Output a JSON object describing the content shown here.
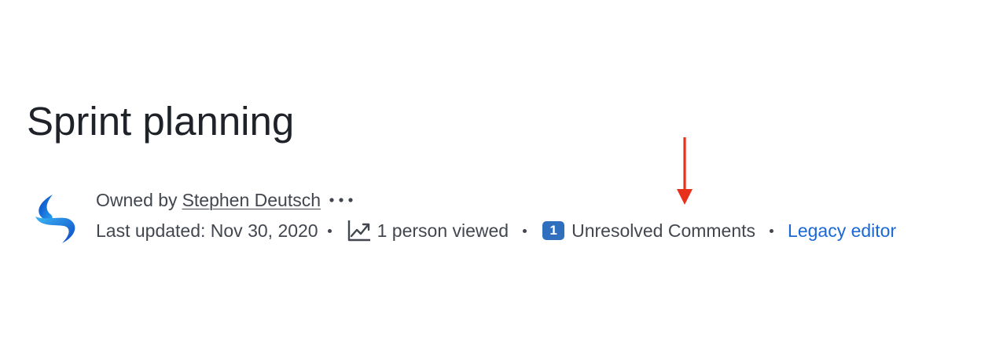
{
  "page": {
    "title": "Sprint planning"
  },
  "byline": {
    "owner_prefix": "Owned by",
    "owner_name": "Stephen Deutsch",
    "more_icon": "more-horizontal-icon",
    "avatar_icon": "space-logo"
  },
  "meta": {
    "last_updated": "Last updated: Nov 30, 2020",
    "views_icon": "analytics-chart-icon",
    "views": "1 person viewed",
    "unresolved_count": "1",
    "unresolved_label": "Unresolved Comments",
    "legacy_editor": "Legacy editor"
  },
  "colors": {
    "title": "#1f2329",
    "text": "#42474f",
    "badge": "#2f6fbe",
    "link": "#1a68d6",
    "annotation": "#e8311c"
  }
}
